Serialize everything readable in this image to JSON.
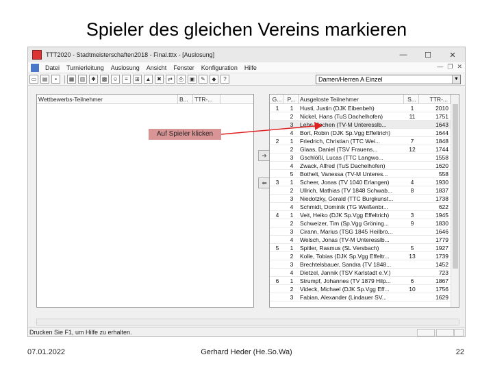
{
  "slide": {
    "title": "Spieler des gleichen Vereins markieren",
    "footer_date": "07.01.2022",
    "footer_author": "Gerhard Heder (He.So.Wa)",
    "page_number": "22"
  },
  "window": {
    "title": "TTT2020 - Stadtmeisterschaften2018 - Final.tttx - [Auslosung]",
    "buttons": {
      "minimize": "—",
      "maximize": "☐",
      "close": "✕"
    }
  },
  "menu": {
    "items": [
      "Datei",
      "Turnierleitung",
      "Auslosung",
      "Ansicht",
      "Fenster",
      "Konfiguration",
      "Hilfe"
    ],
    "mdi": [
      "—",
      "❐",
      "✕"
    ]
  },
  "toolbar": {
    "combo_value": "Damen/Herren A Einzel",
    "combo_arrow": "▼"
  },
  "left_pane": {
    "headers": [
      "Wettbewerbs-Teilnehmer",
      "B...",
      "TTR-..."
    ]
  },
  "right_pane": {
    "headers": [
      "G...",
      "P...",
      "Ausgeloste Teilnehmer",
      "S...",
      "TTR-..."
    ],
    "rows": [
      [
        "1",
        "1",
        "Husti, Justin (DJK Eibenbeh)",
        "1",
        "2010"
      ],
      [
        "",
        "2",
        "Nickel, Hans (TuS Dachelhofen)",
        "11",
        "1751"
      ],
      [
        "",
        "3",
        "Lehn, Jochen (TV-M Unteresslb...",
        "",
        "1643"
      ],
      [
        "",
        "4",
        "Bort, Robin (DJK Sp.Vgg Effeltrich)",
        "",
        "1644"
      ],
      [
        "2",
        "1",
        "Friedrich, Christian (TTC Wei...",
        "7",
        "1848"
      ],
      [
        "",
        "2",
        "Glaas, Daniel (TSV Frauens...",
        "12",
        "1744"
      ],
      [
        "",
        "3",
        "Gschlößl, Lucas (TTC Langwo...",
        "",
        "1558"
      ],
      [
        "",
        "4",
        "Zwack, Alfred (TuS Dachelhofen)",
        "",
        "1620"
      ],
      [
        "",
        "5",
        "Bothelt, Vanessa (TV-M Unteres...",
        "",
        "558"
      ],
      [
        "3",
        "1",
        "Scheer, Jonas (TV 1040 Erlangen)",
        "4",
        "1930"
      ],
      [
        "",
        "2",
        "Ullrich, Mathias (TV 1848 Schwab...",
        "8",
        "1837"
      ],
      [
        "",
        "3",
        "Niedotzky, Gerald (TTC Burgkunst...",
        "",
        "1738"
      ],
      [
        "",
        "4",
        "Schmidt, Dominik (TG Weißenbr...",
        "",
        "622"
      ],
      [
        "4",
        "1",
        "Veit, Heiko (DJK Sp.Vgg Effeltrich)",
        "3",
        "1945"
      ],
      [
        "",
        "2",
        "Schweizer, Tim (Sp.Vgg Gröning...",
        "9",
        "1830"
      ],
      [
        "",
        "3",
        "Cirann, Marius (TSG 1845 Heilbro...",
        "",
        "1646"
      ],
      [
        "",
        "4",
        "Welsch, Jonas (TV-M Unteresslb...",
        "",
        "1779"
      ],
      [
        "5",
        "1",
        "Spitler, Rasmus (SL Versbach)",
        "5",
        "1927"
      ],
      [
        "",
        "2",
        "Kolle, Tobias (DJK Sp.Vgg Effeltr...",
        "13",
        "1739"
      ],
      [
        "",
        "3",
        "Brechtelsbauer, Sandra (TV 1848...",
        "",
        "1452"
      ],
      [
        "",
        "4",
        "Dietzel, Jannik (TSV Karlstadt e.V.)",
        "",
        "723"
      ],
      [
        "6",
        "1",
        "Strumpf, Johannes (TV 1879 Hilp...",
        "6",
        "1867"
      ],
      [
        "",
        "2",
        "Videck, Michael (DJK Sp.Vgg Eff...",
        "10",
        "1756"
      ],
      [
        "",
        "3",
        "Fabian, Alexander (Lindauer SV...",
        "",
        "1629"
      ]
    ]
  },
  "side_buttons": {
    "right": "➜",
    "left": "⬅"
  },
  "status": {
    "text": "Drucken Sie F1, um Hilfe zu erhalten."
  },
  "callout": {
    "text": "Auf Spieler klicken"
  },
  "colors": {
    "callout_bg": "#d99595",
    "arrow": "#e02020"
  }
}
